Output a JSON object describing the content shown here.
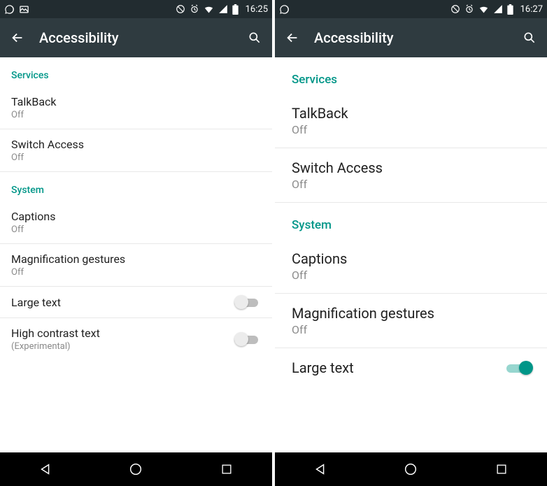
{
  "accent": "#009688",
  "left": {
    "statusbar": {
      "time": "16:25"
    },
    "actionbar": {
      "title": "Accessibility"
    },
    "sections": {
      "services": {
        "header": "Services",
        "talkback": {
          "title": "TalkBack",
          "sub": "Off"
        },
        "switch_access": {
          "title": "Switch Access",
          "sub": "Off"
        }
      },
      "system": {
        "header": "System",
        "captions": {
          "title": "Captions",
          "sub": "Off"
        },
        "magnification": {
          "title": "Magnification gestures",
          "sub": "Off"
        },
        "large_text": {
          "title": "Large text",
          "toggle": false
        },
        "high_contrast": {
          "title": "High contrast text",
          "sub": "(Experimental)",
          "toggle": false
        }
      }
    }
  },
  "right": {
    "statusbar": {
      "time": "16:27"
    },
    "actionbar": {
      "title": "Accessibility"
    },
    "sections": {
      "services": {
        "header": "Services",
        "talkback": {
          "title": "TalkBack",
          "sub": "Off"
        },
        "switch_access": {
          "title": "Switch Access",
          "sub": "Off"
        }
      },
      "system": {
        "header": "System",
        "captions": {
          "title": "Captions",
          "sub": "Off"
        },
        "magnification": {
          "title": "Magnification gestures",
          "sub": "Off"
        },
        "large_text": {
          "title": "Large text",
          "toggle": true
        }
      }
    }
  }
}
